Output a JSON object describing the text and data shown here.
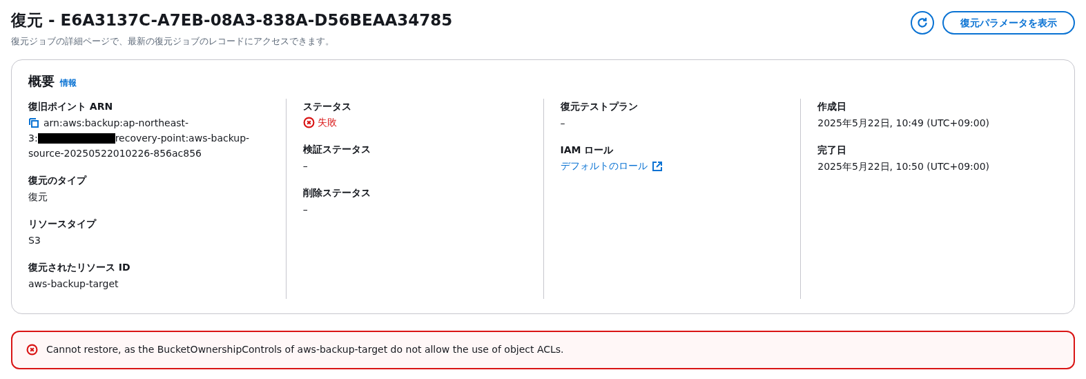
{
  "header": {
    "title": "復元 - E6A3137C-A7EB-08A3-838A-D56BEAA34785",
    "description": "復元ジョブの詳細ページで、最新の復元ジョブのレコードにアクセスできます。",
    "view_button": "復元パラメータを表示"
  },
  "summary": {
    "title": "概要",
    "info_link": "情報",
    "columns": [
      [
        {
          "label": "復旧ポイント ARN",
          "kind": "arn",
          "value_lines": [
            "arn:aws:backup:ap-northeast-",
            "3:",
            "recovery-point:aws-backup-",
            "source-20250522010226-856ac856"
          ],
          "redacted": true
        },
        {
          "label": "復元のタイプ",
          "kind": "text",
          "value": "復元"
        },
        {
          "label": "リソースタイプ",
          "kind": "text",
          "value": "S3"
        },
        {
          "label": "復元されたリソース ID",
          "kind": "text",
          "value": "aws-backup-target"
        }
      ],
      [
        {
          "label": "ステータス",
          "kind": "error",
          "value": "失敗"
        },
        {
          "label": "検証ステータス",
          "kind": "text",
          "value": "–"
        },
        {
          "label": "削除ステータス",
          "kind": "text",
          "value": "–"
        }
      ],
      [
        {
          "label": "復元テストプラン",
          "kind": "text",
          "value": "–"
        },
        {
          "label": "IAM ロール",
          "kind": "link",
          "value": "デフォルトのロール"
        }
      ],
      [
        {
          "label": "作成日",
          "kind": "text",
          "value": "2025年5月22日, 10:49 (UTC+09:00)"
        },
        {
          "label": "完了日",
          "kind": "text",
          "value": "2025年5月22日, 10:50 (UTC+09:00)"
        }
      ]
    ]
  },
  "alert": {
    "kind": "error",
    "message": "Cannot restore, as the BucketOwnershipControls of aws-backup-target do not allow the use of object ACLs."
  }
}
